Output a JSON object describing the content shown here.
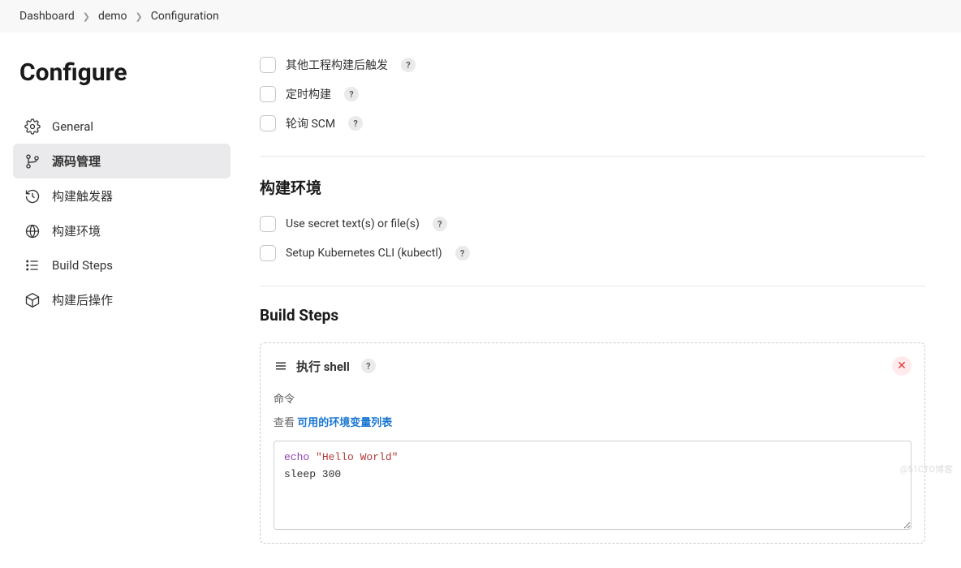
{
  "breadcrumb": {
    "items": [
      "Dashboard",
      "demo",
      "Configuration"
    ]
  },
  "page_title": "Configure",
  "sidebar": {
    "items": [
      {
        "label": "General"
      },
      {
        "label": "源码管理"
      },
      {
        "label": "构建触发器"
      },
      {
        "label": "构建环境"
      },
      {
        "label": "Build Steps"
      },
      {
        "label": "构建后操作"
      }
    ]
  },
  "triggers": {
    "items": [
      {
        "label": "其他工程构建后触发"
      },
      {
        "label": "定时构建"
      },
      {
        "label": "轮询 SCM"
      }
    ]
  },
  "build_env": {
    "title": "构建环境",
    "items": [
      {
        "label": "Use secret text(s) or file(s)"
      },
      {
        "label": "Setup Kubernetes CLI (kubectl)"
      }
    ]
  },
  "build_steps": {
    "title": "Build Steps",
    "step": {
      "title": "执行 shell",
      "field_label": "命令",
      "hint_prefix": "查看 ",
      "hint_link": "可用的环境变量列表",
      "code_echo": "echo",
      "code_str": " \"Hello World\"",
      "code_line2": "sleep 300"
    }
  },
  "help_glyph": "?",
  "watermark": "@51CTO博客"
}
